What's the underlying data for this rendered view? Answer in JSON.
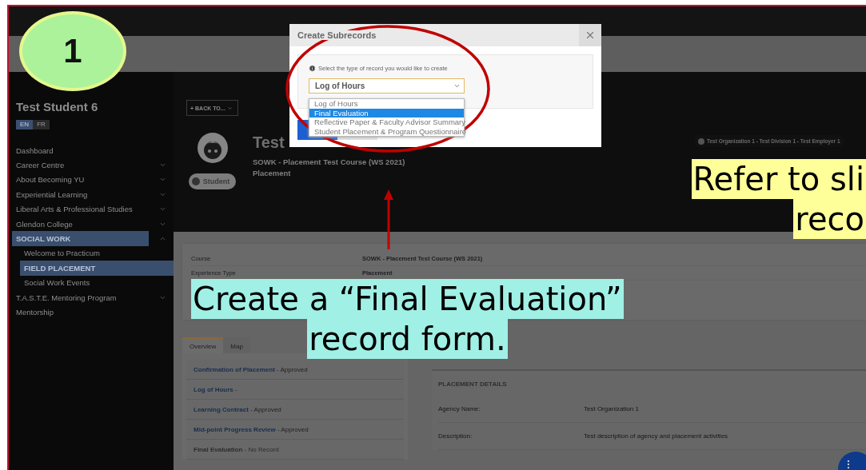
{
  "step_badge": {
    "label": "1"
  },
  "sidebar": {
    "student_name": "Test Student 6",
    "languages": [
      {
        "label": "EN",
        "selected": true
      },
      {
        "label": "FR",
        "selected": false
      }
    ],
    "items": [
      {
        "label": "Dashboard",
        "expandable": false,
        "selected": false
      },
      {
        "label": "Career Centre",
        "expandable": true,
        "expanded": false,
        "selected": false
      },
      {
        "label": "About Becoming YU",
        "expandable": true,
        "expanded": false,
        "selected": false
      },
      {
        "label": "Experiential Learning",
        "expandable": true,
        "expanded": false,
        "selected": false
      },
      {
        "label": "Liberal Arts & Professional Studies",
        "expandable": true,
        "expanded": false,
        "selected": false
      },
      {
        "label": "Glendon College",
        "expandable": true,
        "expanded": false,
        "selected": false
      },
      {
        "label": "SOCIAL WORK",
        "expandable": true,
        "expanded": true,
        "selected": true,
        "children": [
          {
            "label": "Welcome to Practicum",
            "selected": false
          },
          {
            "label": "FIELD PLACEMENT",
            "selected": true
          },
          {
            "label": "Social Work Events",
            "selected": false
          }
        ]
      },
      {
        "label": "T.A.S.T.E. Mentoring Program",
        "expandable": true,
        "expanded": false,
        "selected": false
      },
      {
        "label": "Mentorship",
        "expandable": false,
        "selected": false
      }
    ]
  },
  "header": {
    "back_button": "+ BACK TO...",
    "name": "Test",
    "course": "SOWK - Placement Test Course (WS 2021)",
    "experience": "Placement",
    "role": "Student",
    "organization": "Test Organization 1 - Test Division 1 - Test Employer 1"
  },
  "summary": [
    {
      "label": "Course",
      "value": "SOWK - Placement Test Course (WS 2021)"
    },
    {
      "label": "Experience Type",
      "value": "Placement"
    }
  ],
  "tabs": [
    {
      "label": "Overview",
      "selected": true
    },
    {
      "label": "Map",
      "selected": false
    }
  ],
  "subrecords": [
    {
      "title": "Confirmation of Placement",
      "status": "- Approved",
      "available": true
    },
    {
      "title": "Log of Hours",
      "status": "-",
      "available": true
    },
    {
      "title": "Learning Contract",
      "status": "- Approved",
      "available": true
    },
    {
      "title": "Mid-point Progress Review",
      "status": "- Approved",
      "available": true
    },
    {
      "title": "Final Evaluation",
      "status": "- No Record",
      "available": false
    }
  ],
  "details": {
    "title": "PLACEMENT DETAILS",
    "rows": [
      {
        "label": "Agency Name:",
        "value": "Test Organization 1"
      },
      {
        "label": "Description:",
        "value": "Test description of agency and placement activities"
      }
    ]
  },
  "modal": {
    "title": "Create Subrecords",
    "hint": "Select the type of record you would like to create",
    "select_value": "Log of Hours",
    "open": true,
    "options": [
      {
        "label": "Log of Hours",
        "selected": false
      },
      {
        "label": "Final Evaluation",
        "selected": true
      },
      {
        "label": "Reflective Paper & Faculty Advisor Summary",
        "selected": false
      },
      {
        "label": "Student Placement & Program Questionnaire",
        "selected": false
      }
    ]
  },
  "callouts": [
    {
      "lines": [
        "Create a “Final Evaluation”",
        "record form."
      ],
      "color": "#a0f0e6",
      "kind": "center"
    },
    {
      "lines": [
        "Refer to sli",
        "reco"
      ],
      "color": "#ffff99",
      "kind": "right"
    }
  ]
}
